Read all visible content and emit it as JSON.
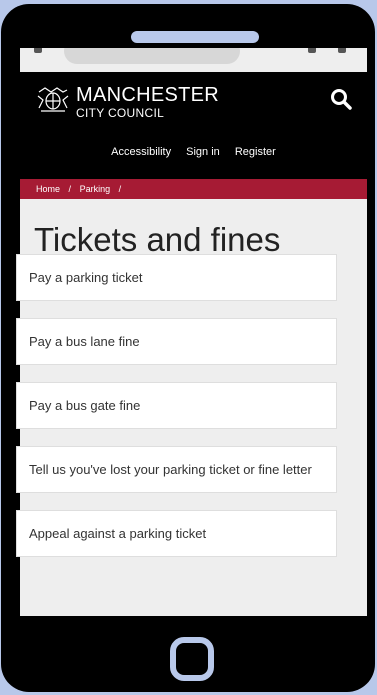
{
  "header": {
    "brand_line1": "MANCHESTER",
    "brand_line2": "CITY COUNCIL",
    "nav": [
      "Accessibility",
      "Sign in",
      "Register"
    ]
  },
  "breadcrumb": {
    "home": "Home",
    "sep": "/",
    "parking": "Parking"
  },
  "page": {
    "title": "Tickets and fines"
  },
  "cards": [
    "Pay a parking ticket",
    "Pay a bus lane fine",
    "Pay a bus gate fine",
    "Tell us you've lost your parking ticket or fine letter",
    "Appeal against a parking ticket"
  ],
  "colors": {
    "background": "#b8c8ea",
    "header": "#000000",
    "breadcrumb_bar": "#a61b34",
    "page_bg": "#eeeeee",
    "card_bg": "#ffffff"
  },
  "icons": {
    "search": "search-icon",
    "logo": "council-crest-icon"
  }
}
